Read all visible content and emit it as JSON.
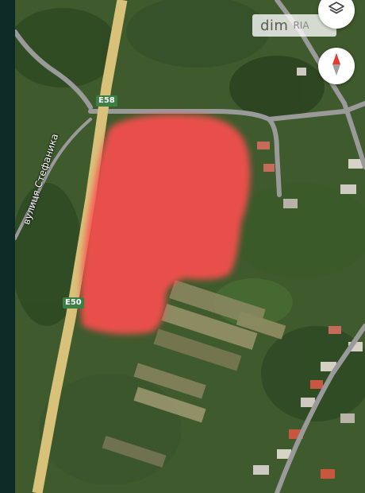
{
  "labels": {
    "road_e58": "E58",
    "road_e50": "E50",
    "street_name": "вулиця Стефаника"
  },
  "watermark": {
    "text": "dim",
    "suffix": "RIA"
  },
  "controls": {
    "layers_icon": "layers-icon",
    "compass_icon": "compass-icon"
  },
  "colors": {
    "highlight": "#ff4d4d",
    "highway": "#d8c27a",
    "local_road": "#9a9a9a",
    "route_label": "#3b7f44"
  }
}
